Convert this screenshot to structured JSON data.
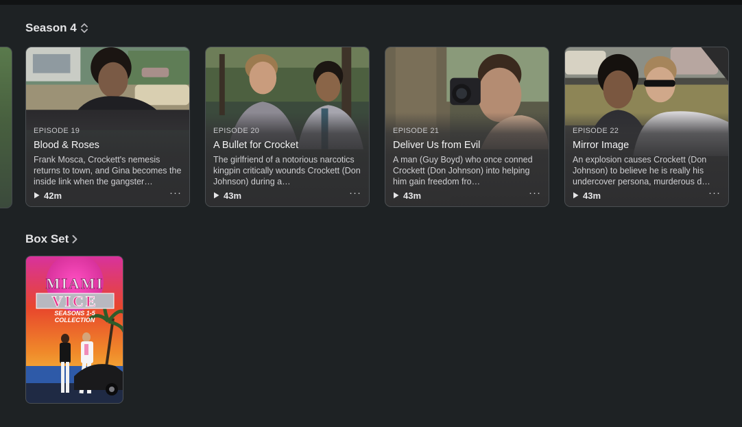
{
  "season": {
    "title": "Season 4"
  },
  "episodes": [
    {
      "label": "EPISODE 19",
      "title": "Blood & Roses",
      "description": "Frank Mosca, Crockett's nemesis returns to town, and Gina becomes the inside link when the gangster…",
      "duration": "42m"
    },
    {
      "label": "EPISODE 20",
      "title": "A Bullet for Crocket",
      "description": "The girlfriend of a notorious narcotics kingpin critically wounds Crockett (Don Johnson) during a…",
      "duration": "43m"
    },
    {
      "label": "EPISODE 21",
      "title": "Deliver Us from Evil",
      "description": "A man (Guy Boyd) who once conned Crockett (Don Johnson) into helping him gain freedom fro…",
      "duration": "43m"
    },
    {
      "label": "EPISODE 22",
      "title": "Mirror Image",
      "description": "An explosion causes Crockett (Don Johnson) to believe he is really his undercover persona, murderous d…",
      "duration": "43m"
    }
  ],
  "box_set": {
    "title": "Box Set",
    "poster_line1": "MIAMI",
    "poster_line2": "VICE",
    "poster_line3": "SEASONS 1-5",
    "poster_line4": "COLLECTION"
  },
  "icons": {
    "sort": "up-down-chevron-icon",
    "chevron": "chevron-right-icon",
    "play": "play-icon",
    "more": "ellipsis-icon"
  },
  "more_glyph": "···"
}
